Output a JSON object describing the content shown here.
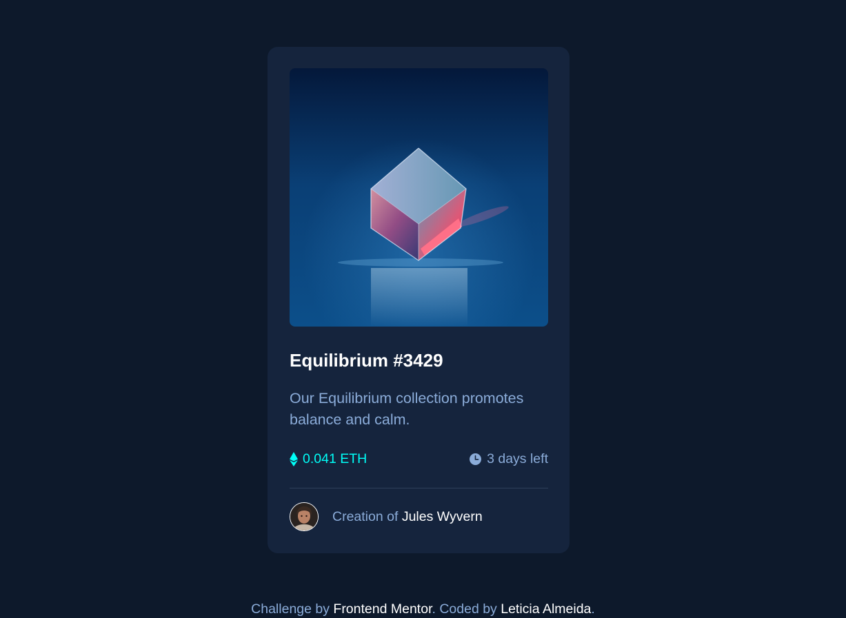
{
  "card": {
    "image_alt": "Equilibrium",
    "title": "Equilibrium #3429",
    "description": "Our Equilibrium collection promotes balance and calm.",
    "price": "0.041 ETH",
    "time_left": "3 days left",
    "creator_prefix": "Creation of ",
    "creator_name": "Jules Wyvern"
  },
  "attribution": {
    "prefix": "Challenge by ",
    "challenge_link": "Frontend Mentor",
    "middle": ". Coded by ",
    "author_link": "Leticia Almeida",
    "suffix": "."
  },
  "colors": {
    "page_bg": "#0d192b",
    "card_bg": "#15243d",
    "accent_cyan": "#00fff8",
    "soft_blue": "#8bacd9",
    "white": "#ffffff",
    "divider": "#2e405a"
  },
  "icons": {
    "price": "ethereum-icon",
    "time": "clock-icon"
  }
}
